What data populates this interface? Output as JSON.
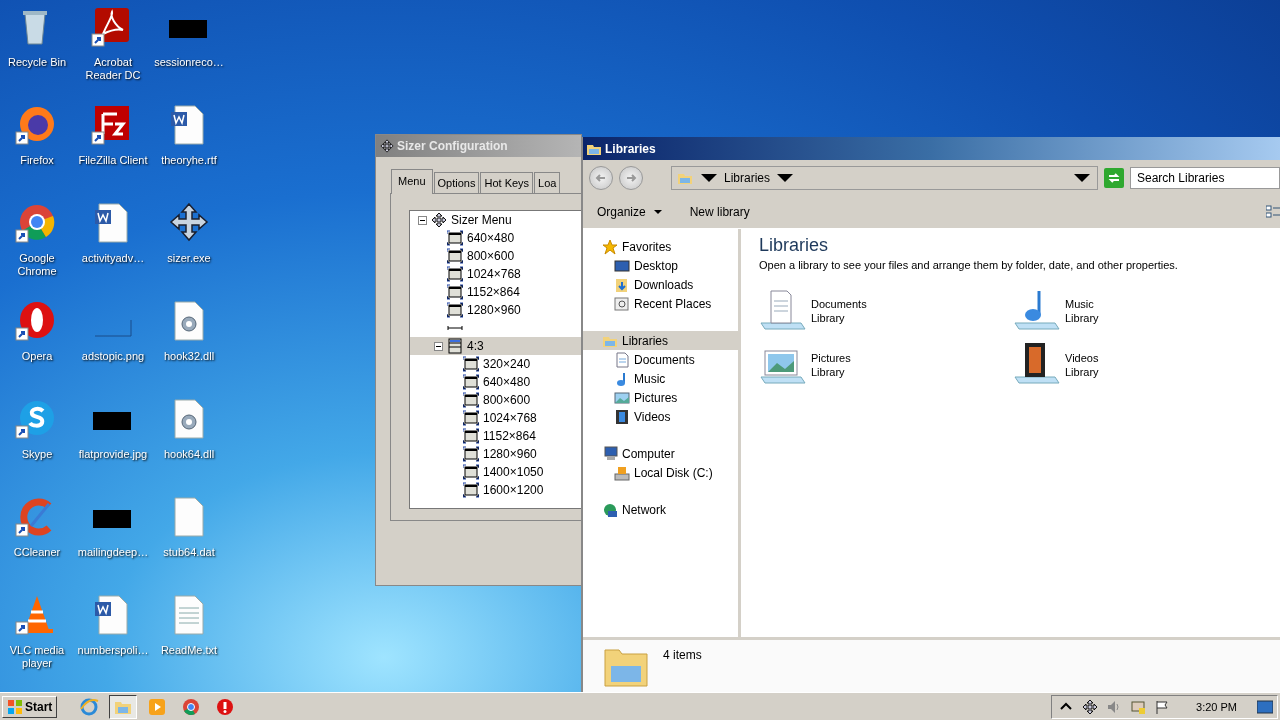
{
  "desktop": {
    "icons": [
      {
        "kind": "recycle-bin",
        "label": "Recycle Bin",
        "shortcut": false
      },
      {
        "kind": "pdf",
        "label": "Acrobat Reader DC",
        "shortcut": true
      },
      {
        "kind": "redacted",
        "label": "sessionreco…",
        "shortcut": false
      },
      {
        "kind": "firefox",
        "label": "Firefox",
        "shortcut": true
      },
      {
        "kind": "filezilla",
        "label": "FileZilla Client",
        "shortcut": true
      },
      {
        "kind": "word",
        "label": "theoryhe.rtf",
        "shortcut": false
      },
      {
        "kind": "chrome",
        "label": "Google Chrome",
        "shortcut": true
      },
      {
        "kind": "word",
        "label": "activityadv…",
        "shortcut": false
      },
      {
        "kind": "move",
        "label": "sizer.exe",
        "shortcut": false
      },
      {
        "kind": "opera",
        "label": "Opera",
        "shortcut": true
      },
      {
        "kind": "blank-image",
        "label": "adstopic.png",
        "shortcut": false
      },
      {
        "kind": "dll",
        "label": "hook32.dll",
        "shortcut": false
      },
      {
        "kind": "skype",
        "label": "Skype",
        "shortcut": true
      },
      {
        "kind": "redacted",
        "label": "flatprovide.jpg",
        "shortcut": false
      },
      {
        "kind": "dll",
        "label": "hook64.dll",
        "shortcut": false
      },
      {
        "kind": "ccleaner",
        "label": "CCleaner",
        "shortcut": true
      },
      {
        "kind": "redacted",
        "label": "mailingdeep…",
        "shortcut": false
      },
      {
        "kind": "file",
        "label": "stub64.dat",
        "shortcut": false
      },
      {
        "kind": "vlc",
        "label": "VLC media player",
        "shortcut": true
      },
      {
        "kind": "word",
        "label": "numberspoli…",
        "shortcut": false
      },
      {
        "kind": "text",
        "label": "ReadMe.txt",
        "shortcut": false
      }
    ]
  },
  "sizer_window": {
    "title": "Sizer Configuration",
    "tabs": [
      {
        "label": "Menu",
        "selected": true
      },
      {
        "label": "Options",
        "selected": false
      },
      {
        "label": "Hot Keys",
        "selected": false
      },
      {
        "label": "Loa",
        "selected": false
      }
    ],
    "tree": [
      {
        "kind": "root",
        "label": "Sizer Menu",
        "expanded": true,
        "selected": false,
        "children": [
          {
            "kind": "size",
            "label": "640×480",
            "selected": false
          },
          {
            "kind": "size",
            "label": "800×600",
            "selected": false
          },
          {
            "kind": "size",
            "label": "1024×768",
            "selected": false
          },
          {
            "kind": "size",
            "label": "1152×864",
            "selected": false
          },
          {
            "kind": "size",
            "label": "1280×960",
            "selected": false
          },
          {
            "kind": "separator",
            "selected": false
          },
          {
            "kind": "group",
            "label": "4:3",
            "expanded": true,
            "selected": true,
            "children": [
              {
                "kind": "size",
                "label": "320×240",
                "selected": false
              },
              {
                "kind": "size",
                "label": "640×480",
                "selected": false
              },
              {
                "kind": "size",
                "label": "800×600",
                "selected": false
              },
              {
                "kind": "size",
                "label": "1024×768",
                "selected": false
              },
              {
                "kind": "size",
                "label": "1152×864",
                "selected": false
              },
              {
                "kind": "size",
                "label": "1280×960",
                "selected": false
              },
              {
                "kind": "size",
                "label": "1400×1050",
                "selected": false
              },
              {
                "kind": "size",
                "label": "1600×1200",
                "selected": false
              }
            ]
          }
        ]
      }
    ]
  },
  "explorer_window": {
    "title": "Libraries",
    "address": "Libraries",
    "search": {
      "placeholder": "Search Libraries"
    },
    "toolbar": [
      {
        "label": "Organize",
        "dropdown": true
      },
      {
        "label": "New library",
        "dropdown": false
      }
    ],
    "nav": [
      {
        "kind": "star",
        "label": "Favorites",
        "selected": false,
        "children": [
          {
            "kind": "desktop",
            "label": "Desktop",
            "selected": false
          },
          {
            "kind": "downloads",
            "label": "Downloads",
            "selected": false
          },
          {
            "kind": "recent",
            "label": "Recent Places",
            "selected": false
          }
        ]
      },
      {
        "kind": "libraries",
        "label": "Libraries",
        "selected": true,
        "children": [
          {
            "kind": "documents",
            "label": "Documents",
            "selected": false
          },
          {
            "kind": "music",
            "label": "Music",
            "selected": false
          },
          {
            "kind": "pictures",
            "label": "Pictures",
            "selected": false
          },
          {
            "kind": "videos",
            "label": "Videos",
            "selected": false
          }
        ]
      },
      {
        "kind": "computer",
        "label": "Computer",
        "selected": false,
        "children": [
          {
            "kind": "disk",
            "label": "Local Disk (C:)",
            "selected": false
          }
        ]
      },
      {
        "kind": "network",
        "label": "Network",
        "selected": false
      }
    ],
    "heading": "Libraries",
    "description": "Open a library to see your files and arrange them by folder, date, and other properties.",
    "libraries": [
      {
        "kind": "documents",
        "name": "Documents",
        "type": "Library"
      },
      {
        "kind": "music",
        "name": "Music",
        "type": "Library"
      },
      {
        "kind": "pictures",
        "name": "Pictures",
        "type": "Library"
      },
      {
        "kind": "videos",
        "name": "Videos",
        "type": "Library"
      }
    ],
    "status": "4 items"
  },
  "taskbar": {
    "start": "Start",
    "apps": [
      {
        "kind": "ie",
        "selected": false
      },
      {
        "kind": "explorer",
        "selected": true
      },
      {
        "kind": "media",
        "selected": false
      },
      {
        "kind": "chrome",
        "selected": false
      },
      {
        "kind": "opera",
        "selected": false
      }
    ],
    "tray": [
      {
        "kind": "up"
      },
      {
        "kind": "move"
      },
      {
        "kind": "volume"
      },
      {
        "kind": "network"
      },
      {
        "kind": "flag"
      }
    ],
    "time": "3:20 PM"
  }
}
